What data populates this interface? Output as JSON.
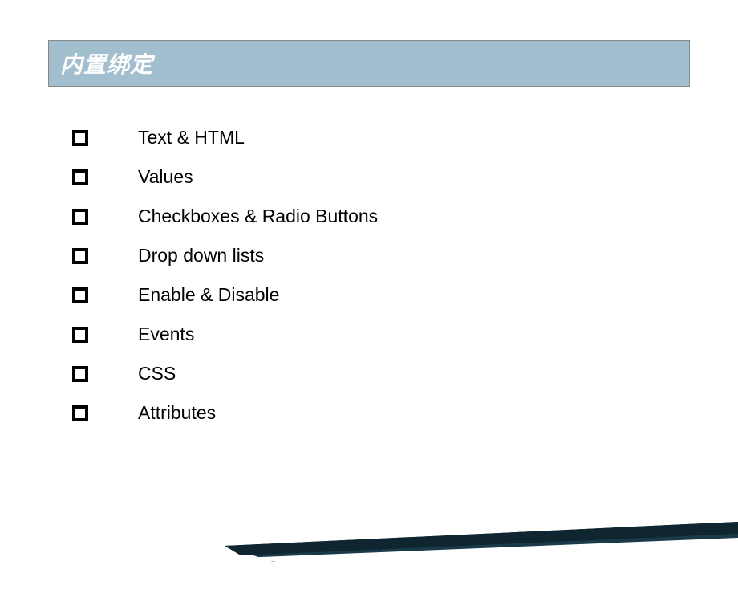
{
  "title": "内置绑定",
  "items": [
    "Text & HTML",
    "Values",
    "Checkboxes & Radio Buttons",
    "Drop down lists",
    "Enable & Disable",
    "Events",
    "CSS",
    "Attributes"
  ]
}
